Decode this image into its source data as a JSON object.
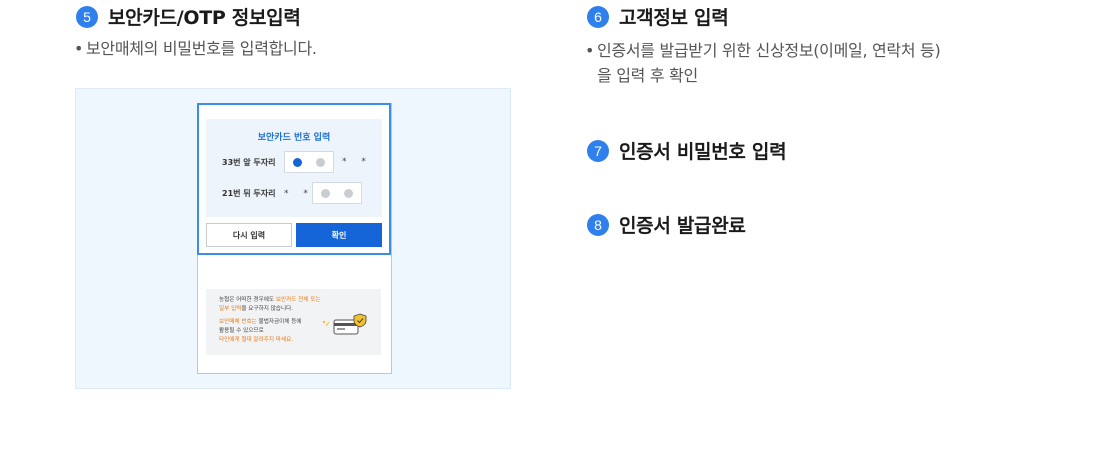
{
  "steps": [
    {
      "number": "5",
      "title": "보안카드/OTP 정보입력",
      "desc_lines": [
        "보안매체의 비밀번호를 입력합니다."
      ]
    },
    {
      "number": "6",
      "title": "고객정보 입력",
      "desc_lines": [
        "인증서를 발급받기 위한 신상정보(이메일, 연락처 등)",
        "을 입력 후 확인"
      ]
    },
    {
      "number": "7",
      "title": "인증서 비밀번호 입력"
    },
    {
      "number": "8",
      "title": "인증서 발급완료"
    }
  ],
  "bullet": "•",
  "mock": {
    "card_title": "보안카드 번호 입력",
    "row1_label": "33번 앞 두자리",
    "row2_label": "21번 뒤 두자리",
    "masked": "* *",
    "retry_label": "다시 입력",
    "ok_label": "확인",
    "notice": {
      "line1_a": "농협은 어떠한 경우에도 ",
      "line1_hl": "보안카드 전체 또는",
      "line2_hl": "일부 입력",
      "line2_b": "을 요구하지 않습니다.",
      "line3_hl": "보안매체 번호는",
      "line3_b": " 불법자금이체 등에",
      "line4": "활용될 수 있으므로",
      "line5_hl": "타인에게 절대 알려주지 마세요."
    }
  },
  "colors": {
    "accent": "#2f80ed",
    "button_primary": "#1565d8",
    "panel_bg": "#eef7fe",
    "warning": "#e97a16"
  }
}
